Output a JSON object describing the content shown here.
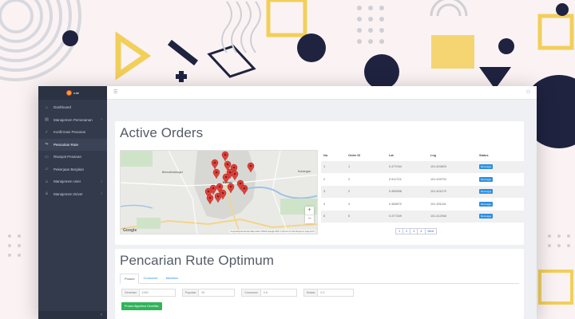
{
  "brand": {
    "name": "rute"
  },
  "sidebar": {
    "items": [
      {
        "label": "Dashboard",
        "icon": "home-icon",
        "has_chevron": false
      },
      {
        "label": "Manajemen Pemesanan",
        "icon": "clipboard-icon",
        "has_chevron": true
      },
      {
        "label": "Konfirmasi Pesanan",
        "icon": "check-icon",
        "has_chevron": false
      },
      {
        "label": "Pencarian Rute",
        "icon": "route-icon",
        "has_chevron": false,
        "active": true
      },
      {
        "label": "Riwayat Pesanan",
        "icon": "document-icon",
        "has_chevron": false
      },
      {
        "label": "Pekerjaan Berjalan",
        "icon": "folder-icon",
        "has_chevron": false
      },
      {
        "label": "Manajemen User",
        "icon": "user-icon",
        "has_chevron": true
      },
      {
        "label": "Manajemen Driver",
        "icon": "driver-icon",
        "has_chevron": true
      }
    ]
  },
  "active_orders": {
    "title": "Active Orders",
    "map": {
      "city_label": "Bekasi",
      "left_label": "Bencahkalanger",
      "right_label": "Kubangan",
      "bottom_label": "",
      "google": "Google",
      "zoom_in": "+",
      "zoom_out": "−",
      "attribution": "Keyboard shortcuts   Map data ©2023 Google   500 m   Terms of Use   Report a map error"
    },
    "table": {
      "headers": [
        "No.",
        "Order ID",
        "Lat",
        "Lng",
        "Status"
      ],
      "rows": [
        [
          "1",
          "1",
          "0.477044",
          "101.404819",
          "Menunggu"
        ],
        [
          "2",
          "2",
          "0.511724",
          "101.439791",
          "Menunggu"
        ],
        [
          "3",
          "2",
          "0.455558",
          "101.401179",
          "Menunggu"
        ],
        [
          "4",
          "4",
          "0.465870",
          "101.391116",
          "Menunggu"
        ],
        [
          "5",
          "5",
          "0.477349",
          "101.412940",
          "Menunggu"
        ]
      ]
    },
    "pagination": [
      "1",
      "2",
      "3",
      "4",
      "Next"
    ]
  },
  "rute": {
    "title": "Pencarian Rute Optimum",
    "tabs": [
      "Proses",
      "Crossover",
      "Mutation"
    ],
    "fields": [
      {
        "label": "Generasi",
        "value": "1000"
      },
      {
        "label": "Populasi",
        "value": "50"
      },
      {
        "label": "Crossover",
        "value": "0.8"
      },
      {
        "label": "Mutasi",
        "value": "0.3"
      }
    ],
    "run_button": "Proses Algoritma Genetika"
  },
  "colors": {
    "sidebar": "#323a4c",
    "accent": "#2d8fe0",
    "button": "#2fb559",
    "pin": "#e0403a"
  }
}
